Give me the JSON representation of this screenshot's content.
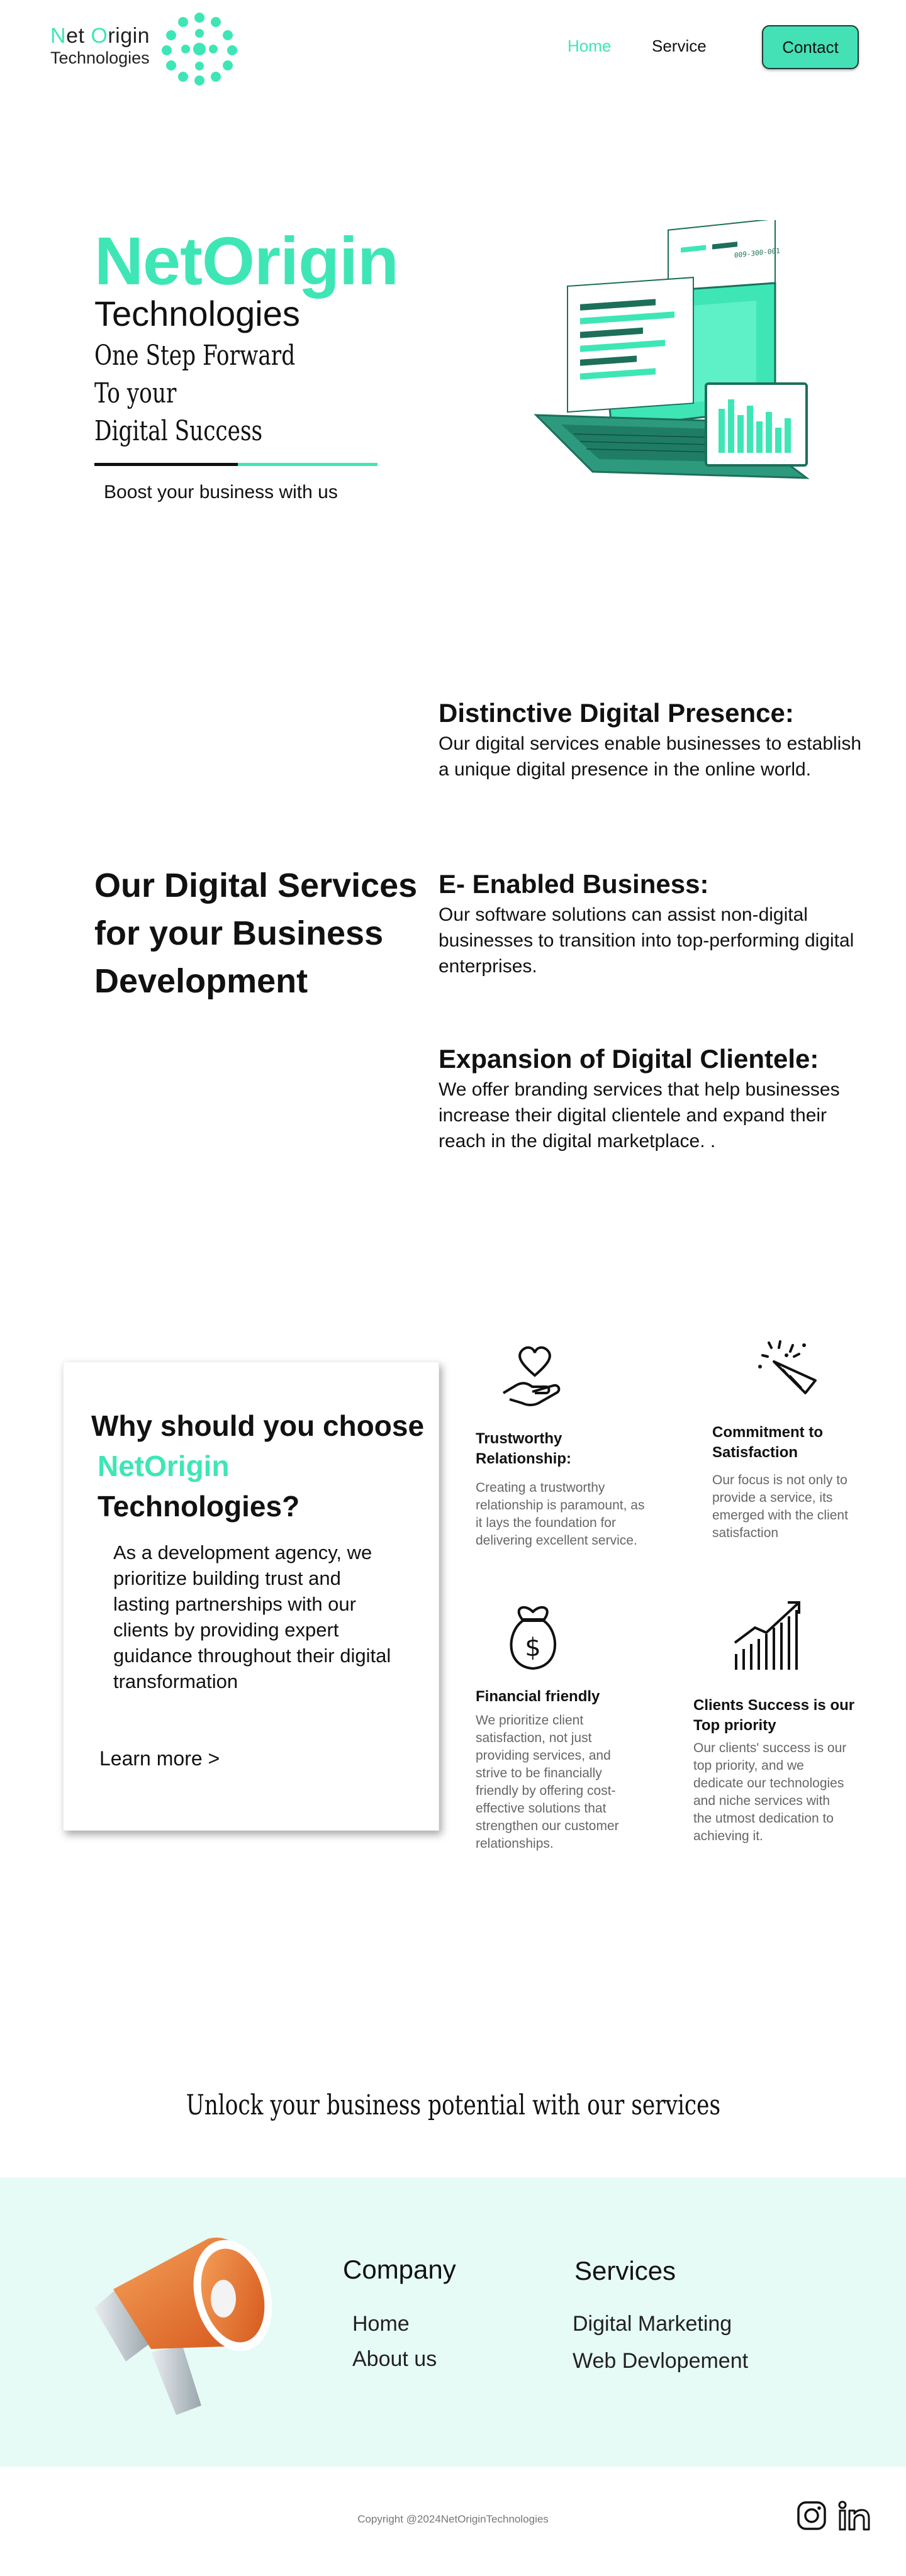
{
  "header": {
    "logo_first": "N",
    "logo_first_rest": "et ",
    "logo_second": "O",
    "logo_second_rest": "rigin",
    "logo_sub": "Technologies",
    "nav": {
      "home": "Home",
      "service": "Service"
    },
    "contact_label": "Contact",
    "accent_color": "#3ee6b6"
  },
  "hero": {
    "brand": "NetOrigin",
    "subtitle": "Technologies",
    "tagline": [
      "One Step Forward",
      "To your",
      "Digital Success"
    ],
    "boost": "Boost your business with us",
    "illustration_icon": "laptop-dashboard-illustration",
    "invoice_text": "009-300-001"
  },
  "services": {
    "title_lines": [
      "Our Digital Services",
      "for your Business",
      "Development"
    ],
    "items": [
      {
        "title": "Distinctive Digital Presence:",
        "text": "Our digital services enable businesses to establish a unique digital presence in the online world."
      },
      {
        "title": "E- Enabled Business:",
        "text": "Our software solutions can assist non-digital businesses to transition into top-performing digital enterprises."
      },
      {
        "title": "Expansion of Digital Clientele:",
        "text": "We offer branding services that help businesses increase their digital clientele and expand their reach in the digital marketplace. ."
      }
    ]
  },
  "why": {
    "title": "Why should you choose",
    "brand": "NetOrigin",
    "tech": "Technologies?",
    "text": "As a development agency, we prioritize building trust and lasting partnerships with our clients by providing expert guidance throughout their digital transformation",
    "learn_more": "Learn more >",
    "features": [
      {
        "icon": "heart-hand-icon",
        "title": "Trustworthy Relationship:",
        "text": "Creating a trustworthy relationship is paramount, as it lays the foundation for delivering excellent service."
      },
      {
        "icon": "party-popper-icon",
        "title": "Commitment to Satisfaction",
        "text": "Our focus is not only to provide a service, its emerged with the client satisfaction"
      },
      {
        "icon": "money-bag-icon",
        "title": "Financial friendly",
        "text": "We prioritize client satisfaction, not just providing services, and strive to be financially friendly by offering cost-effective solutions that strengthen our customer relationships."
      },
      {
        "icon": "growth-chart-icon",
        "title": "Clients Success is our Top priority",
        "text": "Our clients' success is our top priority, and we dedicate our technologies and niche services with the utmost dedication to achieving it."
      }
    ]
  },
  "unlock": "Unlock your business potential with our services",
  "footer": {
    "company_head": "Company",
    "company_links": [
      "Home",
      "About us"
    ],
    "services_head": "Services",
    "services_links": [
      "Digital Marketing",
      "Web Devlopement"
    ],
    "copyright": "Copyright @2024NetOriginTechnologies",
    "social": [
      "instagram-icon",
      "linkedin-icon"
    ],
    "band_color": "#e6fbf5"
  }
}
